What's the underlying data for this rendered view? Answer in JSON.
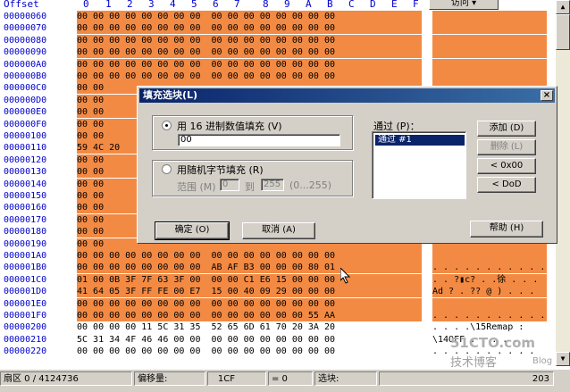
{
  "hex_header": {
    "offset_title": "Offset",
    "columns": [
      "0",
      "1",
      "2",
      "3",
      "4",
      "5",
      "6",
      "7",
      "8",
      "9",
      "A",
      "B",
      "C",
      "D",
      "E",
      "F"
    ],
    "access_button": "访问 ▾"
  },
  "rows": [
    {
      "offset": "00000060",
      "hex": "00 00 00 00 00 00 00 00  00 00 00 00 00 00 00 00",
      "ascii": "",
      "selected": true
    },
    {
      "offset": "00000070",
      "hex": "00 00 00 00 00 00 00 00  00 00 00 00 00 00 00 00",
      "ascii": "",
      "selected": true
    },
    {
      "offset": "00000080",
      "hex": "00 00 00 00 00 00 00 00  00 00 00 00 00 00 00 00",
      "ascii": "",
      "selected": true
    },
    {
      "offset": "00000090",
      "hex": "00 00 00 00 00 00 00 00  00 00 00 00 00 00 00 00",
      "ascii": "",
      "selected": true
    },
    {
      "offset": "000000A0",
      "hex": "00 00 00 00 00 00 00 00  00 00 00 00 00 00 00 00",
      "ascii": "",
      "selected": true
    },
    {
      "offset": "000000B0",
      "hex": "00 00 00 00 00 00 00 00  00 00 00 00 00 00 00 00",
      "ascii": "",
      "selected": true
    },
    {
      "offset": "000000C0",
      "hex": "00 00",
      "ascii": "",
      "selected": true
    },
    {
      "offset": "000000D0",
      "hex": "00 00",
      "ascii": "",
      "selected": true
    },
    {
      "offset": "000000E0",
      "hex": "00 00",
      "ascii": "",
      "selected": true
    },
    {
      "offset": "000000F0",
      "hex": "00 00",
      "ascii": "",
      "selected": true
    },
    {
      "offset": "00000100",
      "hex": "00 00",
      "ascii": "",
      "selected": true
    },
    {
      "offset": "00000110",
      "hex": "59 4C 20",
      "ascii": "",
      "selected": true
    },
    {
      "offset": "00000120",
      "hex": "00 00",
      "ascii": "",
      "selected": true
    },
    {
      "offset": "00000130",
      "hex": "00 00",
      "ascii": "",
      "selected": true
    },
    {
      "offset": "00000140",
      "hex": "00 00",
      "ascii": "",
      "selected": true
    },
    {
      "offset": "00000150",
      "hex": "00 00",
      "ascii": "",
      "selected": true
    },
    {
      "offset": "00000160",
      "hex": "00 00",
      "ascii": "",
      "selected": true
    },
    {
      "offset": "00000170",
      "hex": "00 00",
      "ascii": "",
      "selected": true
    },
    {
      "offset": "00000180",
      "hex": "00 00",
      "ascii": "",
      "selected": true
    },
    {
      "offset": "00000190",
      "hex": "00 00",
      "ascii": "",
      "selected": true
    },
    {
      "offset": "000001A0",
      "hex": "00 00 00 00 00 00 00 00  00 00 00 00 00 00 00 00",
      "ascii": "",
      "selected": true
    },
    {
      "offset": "000001B0",
      "hex": "00 00 00 00 00 00 00 00  AB AF B3 00 00 00 80 01",
      "ascii": ". . . . . . . . . . . . ? . ▮",
      "selected": true
    },
    {
      "offset": "000001C0",
      "hex": "01 00 0B 3F 7F 63 3F 00  00 00 C1 E6 15 00 00 00",
      "ascii": ". . ?▮c? . .徐 . . .",
      "selected": true
    },
    {
      "offset": "000001D0",
      "hex": "41 64 05 3F FF FE 00 E7  15 00 40 09 29 00 00 00",
      "ascii": "Ad ? . ?? @ ) . . .",
      "selected": true
    },
    {
      "offset": "000001E0",
      "hex": "00 00 00 00 00 00 00 00  00 00 00 00 00 00 00 00",
      "ascii": "",
      "selected": true
    },
    {
      "offset": "000001F0",
      "hex": "00 00 00 00 00 00 00 00  00 00 00 00 00 00 55 AA",
      "ascii": ". . . . . . . . . . . . . .U▮",
      "selected": true
    },
    {
      "offset": "00000200",
      "hex": "00 00 00 00 11 5C 31 35  52 65 6D 61 70 20 3A 20",
      "ascii": ". . . .\\15Remap : ",
      "selected": false
    },
    {
      "offset": "00000210",
      "hex": "5C 31 34 4F 46 46 00 00  00 00 00 00 00 00 00 00",
      "ascii": "\\14OFF . . . . . .",
      "selected": false
    },
    {
      "offset": "00000220",
      "hex": "00 00 00 00 00 00 00 00  00 00 00 00 00 00 00 00",
      "ascii": ". . . . . . . . . .",
      "selected": false
    }
  ],
  "dialog": {
    "title": "填充选块(L)",
    "close": "×",
    "opt_hex_label": "用 16 进制数值填充 (V)",
    "hex_value": "00",
    "opt_random_label": "用随机字节填充 (R)",
    "range_label": "范围 (M)",
    "range_from": "0",
    "range_to_label": "到",
    "range_to": "255",
    "range_hint": "(0...255)",
    "passes_label": "通过 (P)：",
    "passes": [
      "通过 #1"
    ],
    "add_button": "添加 (D)",
    "delete_button": "删除 (L)",
    "move_0x00_button": "< 0x00",
    "move_dod_button": "< DoD",
    "ok_button": "确定 (O)",
    "cancel_button": "取消 (A)",
    "help_button": "帮助 (H)"
  },
  "status": {
    "sector_label": "扇区 0 / 4124736",
    "offset_label": "偏移量:",
    "offset_value": "1CF",
    "eq_label": "= 0",
    "selection_label": "选块:",
    "selection_value": "203"
  },
  "watermark": {
    "main": "51CTO.com",
    "sub": "技术博客",
    "blog": "Blog"
  },
  "colors": {
    "selection": "#f28a44",
    "offset_text": "#0000cc",
    "dialog_face": "#d4d0c8",
    "titlebar": "#0a246a"
  }
}
